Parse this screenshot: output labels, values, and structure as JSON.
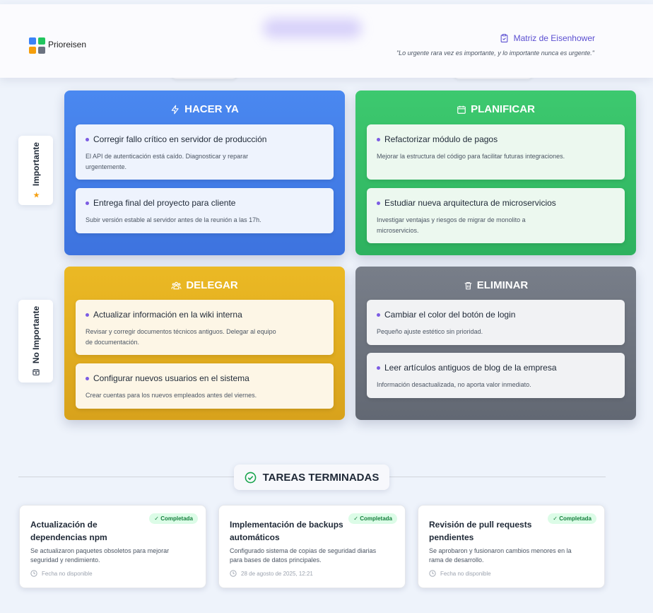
{
  "header": {
    "brand": "Prioreisen",
    "matrix_link": "Matriz de Eisenhower",
    "quote": "\"Lo urgente rara vez es importante, y lo importante nunca es urgente.\""
  },
  "axis": {
    "important": "Importante",
    "not_important": "No Importante"
  },
  "quadrants": {
    "do": {
      "title": "HACER YA",
      "color": "#3f7ee8",
      "tasks": [
        {
          "title": "Corregir fallo crítico en servidor de producción",
          "desc": "El API de autenticación está caído. Diagnosticar y reparar urgentemente."
        },
        {
          "title": "Entrega final del proyecto para cliente",
          "desc": "Subir versión estable al servidor antes de la reunión a las 17h."
        }
      ]
    },
    "plan": {
      "title": "PLANIFICAR",
      "color": "#34bf68",
      "tasks": [
        {
          "title": "Refactorizar módulo de pagos",
          "desc": "Mejorar la estructura del código para facilitar futuras integraciones."
        },
        {
          "title": "Estudiar nueva arquitectura de microservicios",
          "desc": "Investigar ventajas y riesgos de migrar de monolito a microservicios."
        }
      ]
    },
    "delegate": {
      "title": "DELEGAR",
      "color": "#e0ac1f",
      "tasks": [
        {
          "title": "Actualizar información en la wiki interna",
          "desc": "Revisar y corregir documentos técnicos antiguos. Delegar al equipo de documentación."
        },
        {
          "title": "Configurar nuevos usuarios en el sistema",
          "desc": "Crear cuentas para los nuevos empleados antes del viernes."
        }
      ]
    },
    "eliminate": {
      "title": "ELIMINAR",
      "color": "#6e7480",
      "tasks": [
        {
          "title": "Cambiar el color del botón de login",
          "desc": "Pequeño ajuste estético sin prioridad."
        },
        {
          "title": "Leer artículos antiguos de blog de la empresa",
          "desc": "Información desactualizada, no aporta valor inmediato."
        }
      ]
    }
  },
  "completed": {
    "title": "TAREAS TERMINADAS",
    "badge": "✓ Completada",
    "items": [
      {
        "title": "Actualización de dependencias npm",
        "desc": "Se actualizaron paquetes obsoletos para mejorar seguridad y rendimiento.",
        "date": "Fecha no disponible"
      },
      {
        "title": "Implementación de backups automáticos",
        "desc": "Configurado sistema de copias de seguridad diarias para bases de datos principales.",
        "date": "28 de agosto de 2025, 12:21"
      },
      {
        "title": "Revisión de pull requests pendientes",
        "desc": "Se aprobaron y fusionaron cambios menores en la rama de desarrollo.",
        "date": "Fecha no disponible"
      }
    ]
  }
}
